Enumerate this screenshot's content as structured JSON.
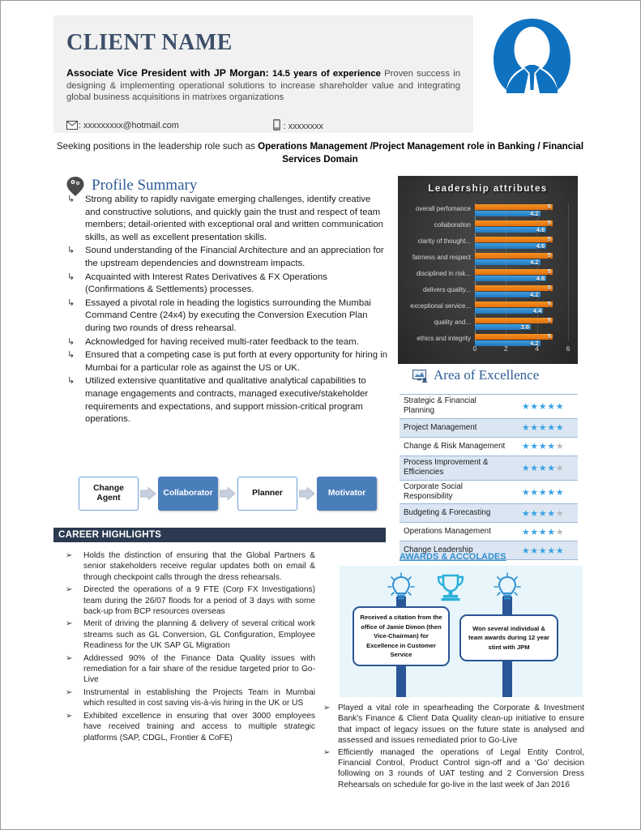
{
  "header": {
    "client_name": "CLIENT NAME",
    "title_bold": "Associate Vice President with JP Morgan:",
    "years": " 14.5 years of experience",
    "summary": " Proven success in designing & implementing operational solutions to increase shareholder value and integrating global business acquisitions in matrixes organizations",
    "email": ": xxxxxxxxx@hotmail.com",
    "phone": ": xxxxxxxx",
    "email_icon": "envelope-icon",
    "phone_icon": "mobile-phone-icon",
    "avatar_icon": "user-avatar-icon"
  },
  "objective": {
    "lead": "Seeking positions in the leadership role such as ",
    "bold": "Operations Management /Project Management role in Banking / Financial Services Domain"
  },
  "profile": {
    "heading": "Profile Summary",
    "heading_icon": "brain-pin-icon",
    "bullet_glyph": "↳",
    "items": [
      "Strong ability to rapidly navigate emerging challenges, identify creative and constructive solutions, and quickly gain the trust and respect of team members; detail-oriented with exceptional oral and written communication skills, as well as excellent presentation skills.",
      "Sound understanding of the Financial Architecture and an appreciation for the upstream dependencies and downstream impacts.",
      "Acquainted with Interest Rates Derivatives & FX Operations (Confirmations & Settlements) processes.",
      "Essayed a pivotal role in heading the logistics surrounding the Mumbai Command Centre (24x4) by executing the Conversion Execution Plan during two rounds of dress rehearsal.",
      "Acknowledged for having received multi-rater feedback to the team.",
      "Ensured that a competing case is put forth at every opportunity for hiring in Mumbai for a particular role as against the US or UK.",
      "Utilized extensive quantitative and qualitative analytical capabilities to manage engagements and contracts, managed executive/stakeholder requirements and expectations, and support mission-critical program operations."
    ]
  },
  "flow": {
    "arrow_icon": "chevron-right-arrow-icon",
    "steps": [
      {
        "label": "Change Agent",
        "style": "white"
      },
      {
        "label": "Collaborator",
        "style": "blue"
      },
      {
        "label": "Planner",
        "style": "white"
      },
      {
        "label": "Motivator",
        "style": "blue"
      }
    ]
  },
  "career": {
    "heading": "CAREER HIGHLIGHTS",
    "bullet_glyph": "➢",
    "items": [
      "Holds the distinction of ensuring that the Global Partners & senior stakeholders receive regular updates both on email & through checkpoint calls through the dress rehearsals.",
      "Directed the operations of a 9 FTE (Corp FX Investigations) team during the 26/07 floods for a period of 3 days with some back-up from BCP resources overseas",
      "Merit of driving the planning & delivery of several critical work streams such as GL Conversion, GL Configuration, Employee Readiness for the UK SAP GL Migration",
      "Addressed 90% of the Finance Data Quality issues with remediation for a fair share of the residue targeted prior to Go-Live",
      "Instrumental in establishing the Projects Team in Mumbai which resulted in cost saving vis-à-vis hiring in the UK or US",
      "Exhibited excellence in ensuring that over 3000 employees have received training and access to multiple strategic platforms (SAP, CDGL, Frontier & CoFE)"
    ]
  },
  "chart_data": {
    "type": "bar",
    "orientation": "horizontal",
    "title": "Leadership attributes",
    "xlabel": "",
    "ylabel": "",
    "xlim": [
      0,
      6
    ],
    "xticks": [
      0,
      2,
      4,
      6
    ],
    "grid": true,
    "legend": false,
    "categories": [
      "overall perfomance",
      "collaboration",
      "clarity of thought...",
      "fairness and respect",
      "disciplined in risk...",
      "delivers quality...",
      "exceptional service...",
      "quality and...",
      "ethics and integrity"
    ],
    "series": [
      {
        "name": "target",
        "color": "#ef7d17",
        "values": [
          5,
          5,
          5,
          5,
          5,
          5,
          5,
          5,
          5
        ]
      },
      {
        "name": "rating",
        "color": "#2e86c8",
        "values": [
          4.2,
          4.6,
          4.6,
          4.2,
          4.6,
          4.2,
          4.4,
          3.6,
          4.2
        ]
      }
    ]
  },
  "excellence": {
    "heading": "Area of Excellence",
    "heading_icon": "presentation-screen-icon",
    "max_stars": 5,
    "rows": [
      {
        "label": "Strategic & Financial Planning",
        "stars": 5
      },
      {
        "label": "Project Management",
        "stars": 5
      },
      {
        "label": "Change & Risk Management",
        "stars": 4
      },
      {
        "label": "Process Improvement & Efficiencies",
        "stars": 4
      },
      {
        "label": "Corporate Social Responsibility",
        "stars": 5
      },
      {
        "label": "Budgeting & Forecasting",
        "stars": 4
      },
      {
        "label": "Operations Management",
        "stars": 4
      },
      {
        "label": "Change Leadership",
        "stars": 5
      }
    ]
  },
  "awards": {
    "heading": "AWARDS & ACCOLADES",
    "bulb_icon": "lightbulb-icon",
    "trophy_icon": "trophy-icon",
    "cards": [
      "Received a citation from the office of Jamie Dimon (then Vice-Chairman) for Excellence in Customer Service",
      "Won several individual & team awards during 12 year stint with JPM"
    ]
  },
  "bottom_right": {
    "bullet_glyph": "➢",
    "items": [
      "Played a vital role in spearheading the Corporate & Investment Bank's Finance & Client Data Quality clean-up initiative to ensure that impact of legacy issues on the future state is analysed and assessed and issues remediated prior to Go-Live",
      "Efficiently managed the operations of Legal Entity Control, Financial Control, Product Control sign-off and a ‘Go’ decision following on 3 rounds of UAT testing and 2 Conversion Dress Rehearsals on schedule for go-live in the last week of Jan 2016"
    ]
  }
}
